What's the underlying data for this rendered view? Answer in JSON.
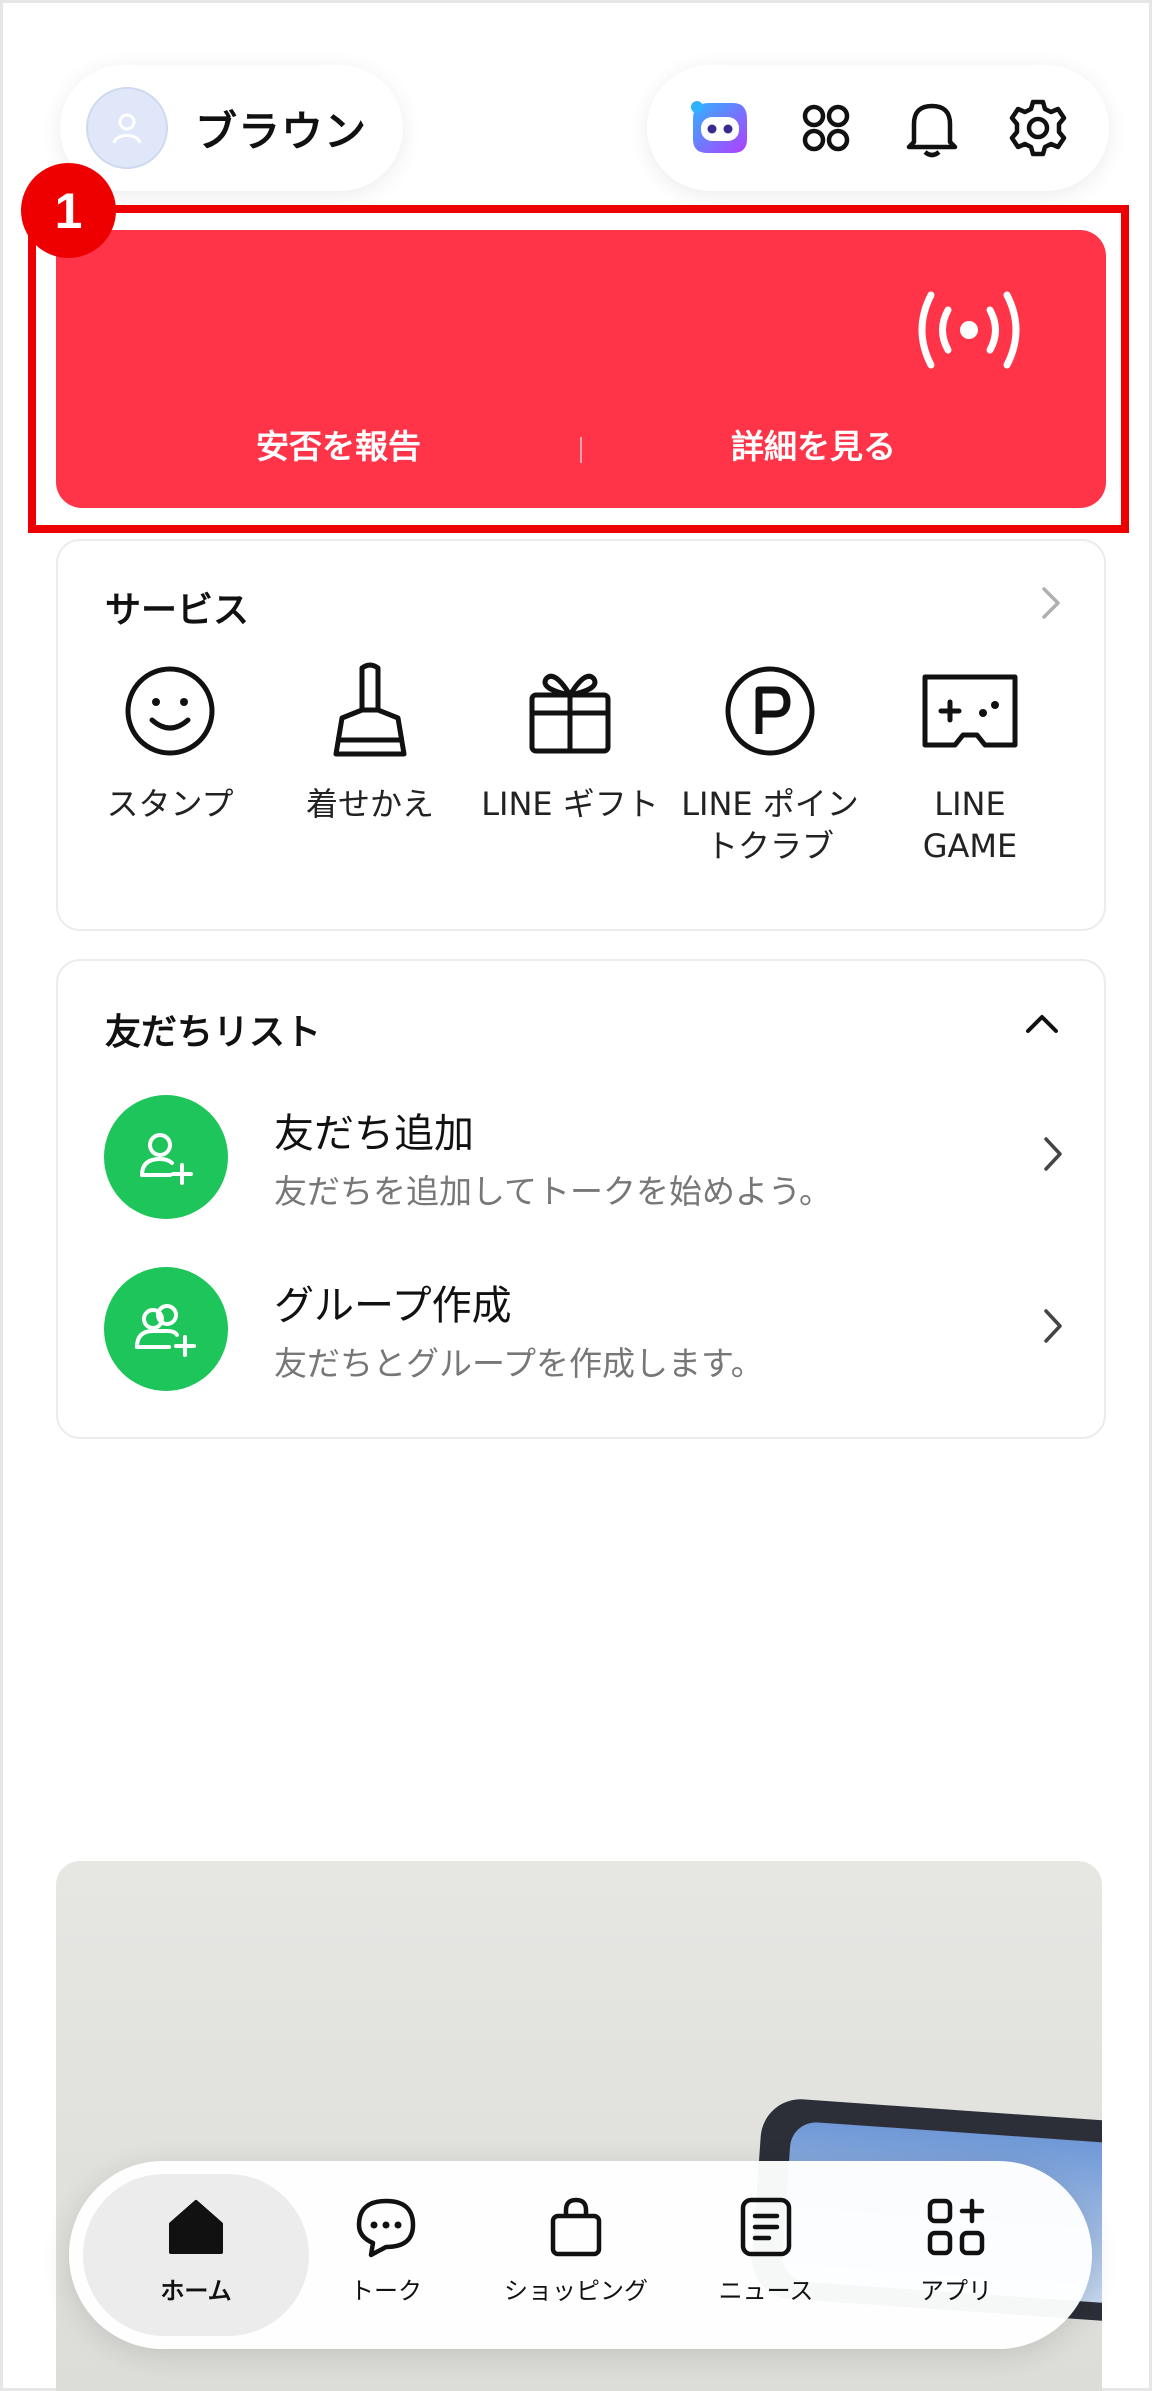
{
  "header": {
    "profile_name": "ブラウン",
    "icons": [
      "ai-assistant-icon",
      "apps-grid-icon",
      "bell-icon",
      "gear-icon"
    ]
  },
  "step_marker": "1",
  "alert_banner": {
    "icon": "broadcast-icon",
    "report_label": "安否を報告",
    "details_label": "詳細を見る",
    "color": "#ff3448"
  },
  "services": {
    "title": "サービス",
    "items": [
      {
        "icon": "smile-icon",
        "label": "スタンプ"
      },
      {
        "icon": "brush-icon",
        "label": "着せかえ"
      },
      {
        "icon": "gift-icon",
        "label": "LINE ギフト"
      },
      {
        "icon": "points-icon",
        "label": "LINE ポイン\nトクラブ"
      },
      {
        "icon": "gamepad-icon",
        "label": "LINE\nGAME"
      }
    ]
  },
  "friends": {
    "title": "友だちリスト",
    "rows": [
      {
        "icon": "add-friend-icon",
        "title": "友だち追加",
        "subtitle": "友だちを追加してトークを始めよう。"
      },
      {
        "icon": "create-group-icon",
        "title": "グループ作成",
        "subtitle": "友だちとグループを作成します。"
      }
    ],
    "accent": "#1ec55a"
  },
  "bottom_nav": {
    "items": [
      {
        "icon": "home-icon",
        "label": "ホーム",
        "active": true
      },
      {
        "icon": "chat-icon",
        "label": "トーク",
        "active": false
      },
      {
        "icon": "shopping-bag-icon",
        "label": "ショッピング",
        "active": false
      },
      {
        "icon": "news-icon",
        "label": "ニュース",
        "active": false
      },
      {
        "icon": "apps-icon",
        "label": "アプリ",
        "active": false
      }
    ]
  }
}
